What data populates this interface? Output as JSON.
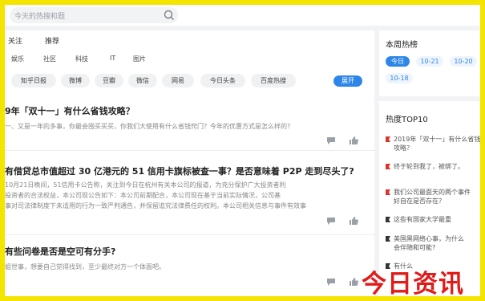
{
  "search": {
    "placeholder": "今天的热搜和题"
  },
  "feed_tabs": [
    "关注",
    "推荐"
  ],
  "categories": [
    "娱乐",
    "社区",
    "科技",
    "IT",
    "图片"
  ],
  "chips": [
    "知乎日报",
    "微博",
    "豆瓣",
    "微信",
    "网易",
    "今日头条",
    "百度热搜"
  ],
  "chips_more": "展开",
  "articles": [
    {
      "title": "9年「双十一」有什么省钱攻略？",
      "lines": [
        "一、又是一年的多事，你最会囤买买买，你我们大使用有什么省钱窍门？今年的优惠方式是怎么样的?"
      ]
    },
    {
      "title": "有借贷总市值超过 30 亿港元的 51 信用卡旗标被查一事？是否意味着 P2P 走到尽头了?",
      "lines": [
        "10月21日晚间，51信用卡公告称，关注到今日在杭州有关本公司的报道，为充分保护广大投资者利",
        "投资者的合法权益，本公司现公告如下：本公司前期配合，本公司现在基于当前实际情况，公司基",
        "事对司法律制度下未适用的行为一致严判通告，并保留追究法律费任的权利。本公司相关信息与事件有效事"
      ]
    },
    {
      "title": "有些问卷是否是空可有分手?",
      "lines": [
        "姐世事，想要自己觉得找到，至少最终对方一个体面吧。"
      ]
    }
  ],
  "hot_dates": {
    "title": "本周热榜",
    "dates": [
      "今日",
      "10-21",
      "10-20",
      "10-18"
    ]
  },
  "hot_top": {
    "title": "热度TOP10",
    "items": [
      [
        "2019年「双十一」有什么省钱",
        "攻略？"
      ],
      [
        "终于轮到我了，被绑了。"
      ],
      [
        "我们公司最面天的两个事件",
        "好自在是否存在？"
      ],
      [
        "这些有国家大学最重"
      ],
      [
        "美国黑网络心事，为什么",
        "会伴随和可能?"
      ],
      [
        "有什么"
      ]
    ]
  },
  "watermark": "今日资讯",
  "colors": {
    "accent": "#2e86e8",
    "frame": "#f5e400",
    "watermark": "#e11a1a",
    "flag": "#d9352b"
  }
}
